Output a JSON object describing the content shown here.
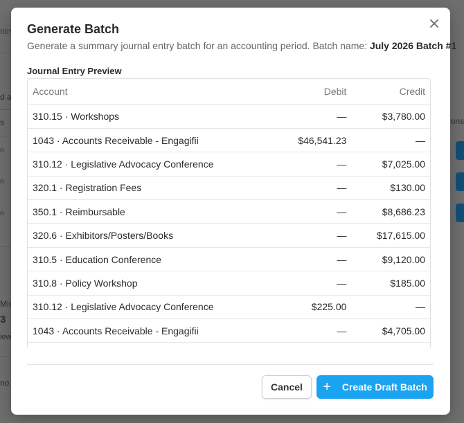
{
  "background": {
    "fragments": [
      "ntry",
      "d an",
      "s",
      "n",
      "n",
      "n",
      "tions",
      "Mis",
      "3",
      "iew",
      "no f"
    ]
  },
  "modal": {
    "title": "Generate Batch",
    "subtitle_prefix": "Generate a summary journal entry batch for an accounting period. Batch name:",
    "batch_name": "July 2026 Batch #1",
    "section_label": "Journal Entry Preview",
    "close_icon": "close-icon",
    "table": {
      "headers": {
        "account": "Account",
        "debit": "Debit",
        "credit": "Credit"
      },
      "rows": [
        {
          "account": "310.15 · Workshops",
          "debit": "—",
          "credit": "$3,780.00"
        },
        {
          "account": "1043 · Accounts Receivable - Engagifii",
          "debit": "$46,541.23",
          "credit": "—"
        },
        {
          "account": "310.12 · Legislative Advocacy Conference",
          "debit": "—",
          "credit": "$7,025.00"
        },
        {
          "account": "320.1 · Registration Fees",
          "debit": "—",
          "credit": "$130.00"
        },
        {
          "account": "350.1 · Reimbursable",
          "debit": "—",
          "credit": "$8,686.23"
        },
        {
          "account": "320.6 · Exhibitors/Posters/Books",
          "debit": "—",
          "credit": "$17,615.00"
        },
        {
          "account": "310.5 · Education Conference",
          "debit": "—",
          "credit": "$9,120.00"
        },
        {
          "account": "310.8 · Policy Workshop",
          "debit": "—",
          "credit": "$185.00"
        },
        {
          "account": "310.12 · Legislative Advocacy Conference",
          "debit": "$225.00",
          "credit": "—"
        },
        {
          "account": "1043 · Accounts Receivable - Engagifii",
          "debit": "—",
          "credit": "$4,705.00"
        },
        {
          "account": "",
          "debit": "",
          "credit": ""
        }
      ]
    },
    "buttons": {
      "cancel": "Cancel",
      "create_icon": "+",
      "create": "Create Draft Batch"
    }
  },
  "colors": {
    "overlay": "#6f6f70",
    "primary": "#1aa3f0",
    "bg_button": "#124e78"
  }
}
